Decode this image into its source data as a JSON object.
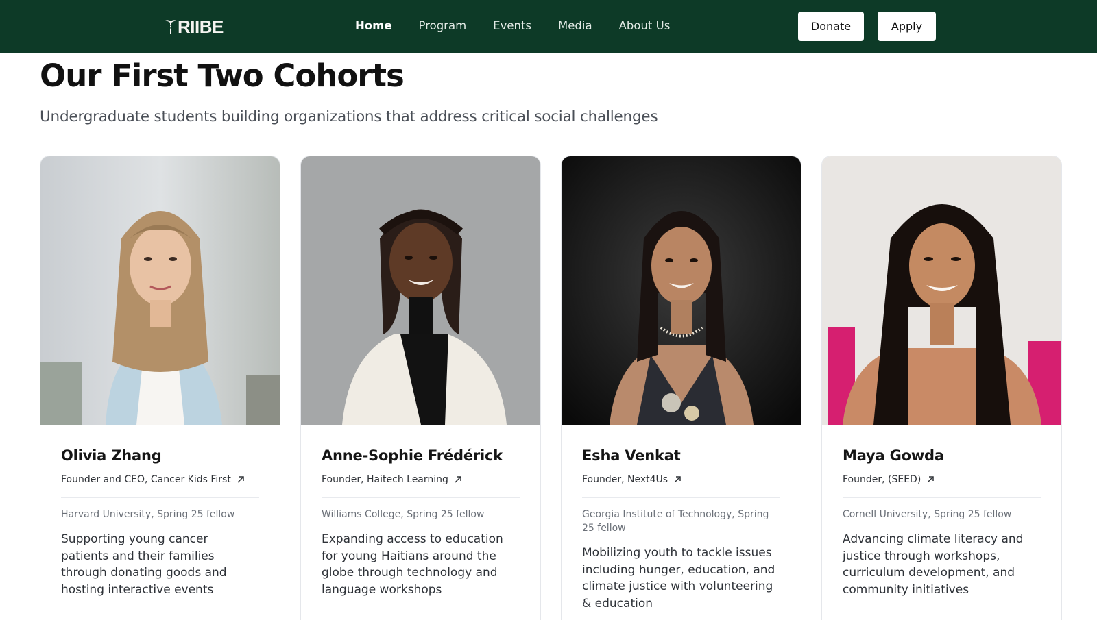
{
  "nav": {
    "logo": "TRIIBE",
    "links": [
      "Home",
      "Program",
      "Events",
      "Media",
      "About Us"
    ],
    "active": "Home",
    "donate_label": "Donate",
    "apply_label": "Apply"
  },
  "header": {
    "title": "Our First Two Cohorts",
    "subtitle": "Undergraduate students building organizations that address critical social challenges"
  },
  "fellows": [
    {
      "name": "Olivia Zhang",
      "role": "Founder and CEO, Cancer Kids First",
      "school": "Harvard University, Spring 25 fellow",
      "description": "Supporting young cancer patients and their families through donating goods and hosting interactive events"
    },
    {
      "name": "Anne-Sophie Frédérick",
      "role": "Founder, Haitech Learning",
      "school": "Williams College, Spring 25 fellow",
      "description": "Expanding access to education for young Haitians around the globe through technology and language workshops"
    },
    {
      "name": "Esha Venkat",
      "role": "Founder, Next4Us",
      "school": "Georgia Institute of Technology, Spring 25 fellow",
      "description": "Mobilizing youth to tackle issues including hunger, education, and climate justice with volunteering & education"
    },
    {
      "name": "Maya Gowda",
      "role": "Founder, (SEED)",
      "school": "Cornell University, Spring 25 fellow",
      "description": "Advancing climate literacy and justice through workshops, curriculum development, and community initiatives"
    }
  ],
  "colors": {
    "nav_bg": "#0d3a27",
    "button_bg": "#ffffff",
    "title": "#111111",
    "subtitle": "#4a4f57"
  },
  "icons": {
    "external_link": "arrow-up-right-icon",
    "logo_mark": "caduceus-icon"
  }
}
